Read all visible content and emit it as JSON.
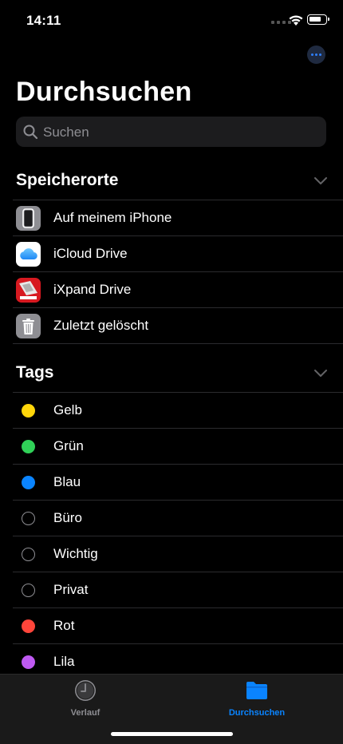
{
  "status_bar": {
    "time": "14:11"
  },
  "header": {
    "title": "Durchsuchen",
    "more_icon": "ellipsis-icon"
  },
  "search": {
    "placeholder": "Suchen"
  },
  "locations": {
    "heading": "Speicherorte",
    "items": [
      {
        "label": "Auf meinem iPhone",
        "icon": "iphone-icon"
      },
      {
        "label": "iCloud Drive",
        "icon": "icloud-icon"
      },
      {
        "label": "iXpand Drive",
        "icon": "ixpand-drive-icon"
      },
      {
        "label": "Zuletzt gelöscht",
        "icon": "trash-icon"
      }
    ]
  },
  "tags": {
    "heading": "Tags",
    "items": [
      {
        "label": "Gelb",
        "color": "#ffd60a",
        "filled": true
      },
      {
        "label": "Grün",
        "color": "#30d158",
        "filled": true
      },
      {
        "label": "Blau",
        "color": "#0a84ff",
        "filled": true
      },
      {
        "label": "Büro",
        "color": "#8e8e93",
        "filled": false
      },
      {
        "label": "Wichtig",
        "color": "#8e8e93",
        "filled": false
      },
      {
        "label": "Privat",
        "color": "#8e8e93",
        "filled": false
      },
      {
        "label": "Rot",
        "color": "#ff453a",
        "filled": true
      },
      {
        "label": "Lila",
        "color": "#bf5af2",
        "filled": true
      }
    ]
  },
  "tab_bar": {
    "tabs": [
      {
        "label": "Verlauf",
        "icon": "clock-icon",
        "active": false
      },
      {
        "label": "Durchsuchen",
        "icon": "folder-icon",
        "active": true
      }
    ],
    "active_color": "#0a84ff",
    "inactive_color": "#8e8e93"
  }
}
